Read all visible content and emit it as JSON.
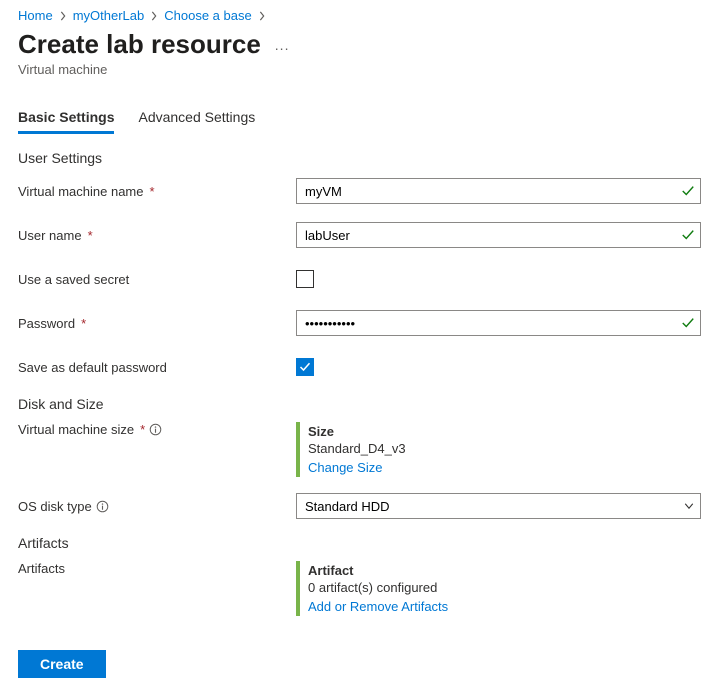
{
  "breadcrumb": {
    "home": "Home",
    "lab": "myOtherLab",
    "choose": "Choose a base"
  },
  "page": {
    "title": "Create lab resource",
    "subtitle": "Virtual machine",
    "more_actions": "..."
  },
  "tabs": {
    "basic": "Basic Settings",
    "advanced": "Advanced Settings"
  },
  "sections": {
    "user_settings": "User Settings",
    "disk_and_size": "Disk and Size",
    "artifacts": "Artifacts"
  },
  "form": {
    "vm_name": {
      "label": "Virtual machine name",
      "value": "myVM"
    },
    "user_name": {
      "label": "User name",
      "value": "labUser"
    },
    "use_saved_secret": {
      "label": "Use a saved secret",
      "checked": false
    },
    "password": {
      "label": "Password",
      "value": "•••••••••••"
    },
    "save_default": {
      "label": "Save as default password",
      "checked": true
    },
    "vm_size": {
      "label": "Virtual machine size",
      "card_title": "Size",
      "value": "Standard_D4_v3",
      "link": "Change Size"
    },
    "os_disk": {
      "label": "OS disk type",
      "value": "Standard HDD"
    },
    "artifacts": {
      "label": "Artifacts",
      "card_title": "Artifact",
      "value": "0 artifact(s) configured",
      "link": "Add or Remove Artifacts"
    }
  },
  "actions": {
    "create": "Create"
  }
}
